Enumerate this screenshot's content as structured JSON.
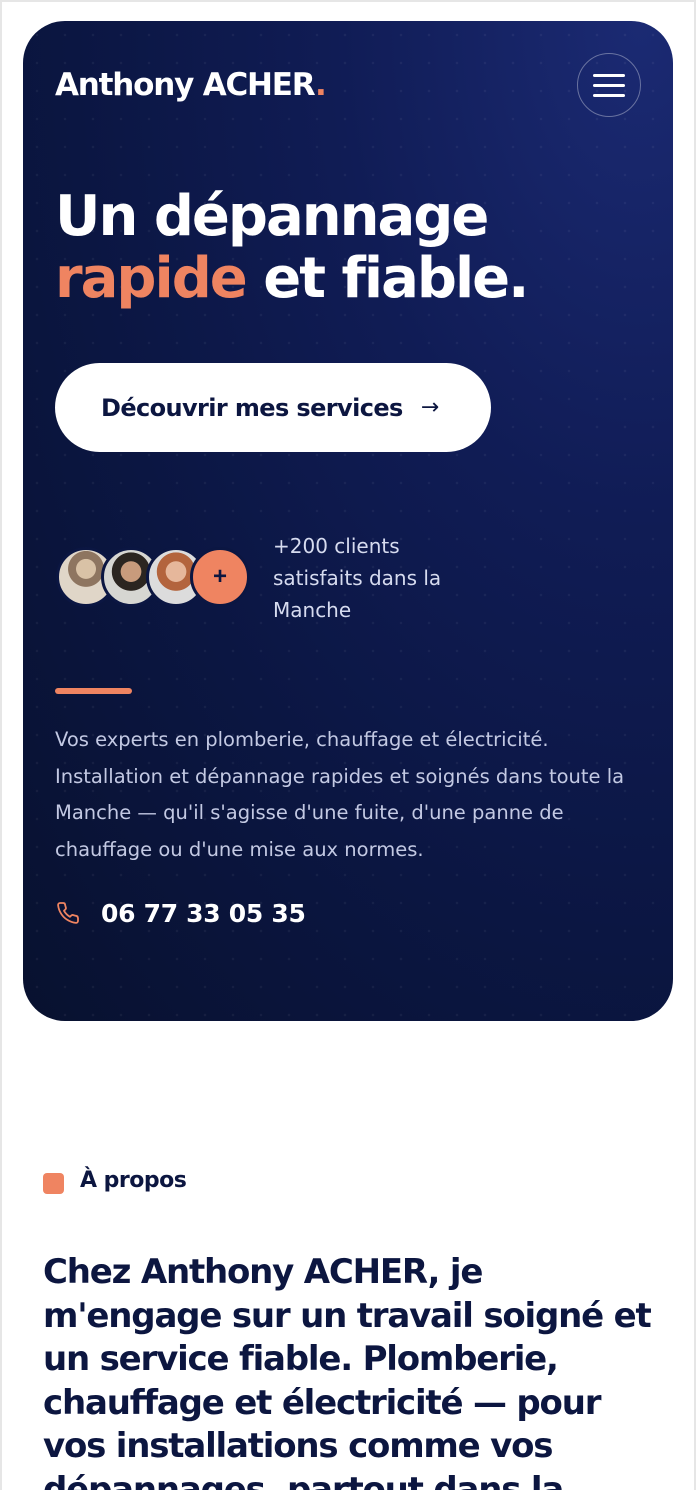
{
  "header": {
    "logo_text": "Anthony ACHER",
    "logo_dot": ".",
    "menu_icon": "hamburger-menu-icon"
  },
  "hero": {
    "headline_line1": "Un dépannage",
    "headline_accent": "rapide",
    "headline_rest": " et fiable.",
    "cta_label": "Découvrir mes services",
    "cta_arrow": "→",
    "avatars_more": "+",
    "clients_text": "+200 clients satisfaits dans la Manche",
    "description": "Vos experts en plomberie, chauffage et électricité. Installation et dépannage rapides et soignés dans toute la Manche — qu'il s'agisse d'une fuite, d'une panne de chauffage ou d'une mise aux normes.",
    "phone": "06 77 33 05 35",
    "phone_icon": "phone-icon"
  },
  "about": {
    "label": "À propos",
    "text": "Chez Anthony ACHER, je m'engage sur un travail soigné et un service fiable. Plomberie, chauffage et électricité — pour vos installations comme vos dépannages, partout dans la Manche."
  },
  "colors": {
    "navy": "#0b1642",
    "accent": "#ef8461",
    "white": "#ffffff"
  }
}
